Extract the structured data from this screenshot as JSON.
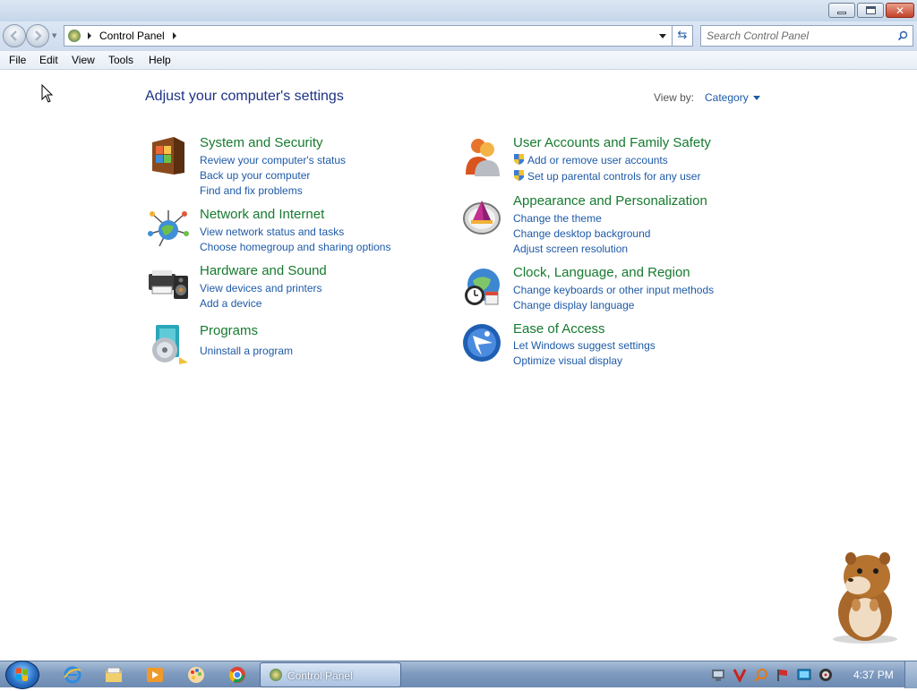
{
  "window": {
    "caption_buttons": {
      "minimize": "minimize",
      "maximize": "maximize",
      "close": "✕"
    }
  },
  "address": {
    "path": "Control Panel",
    "search_placeholder": "Search Control Panel"
  },
  "menu": [
    "File",
    "Edit",
    "View",
    "Tools",
    "Help"
  ],
  "main": {
    "title": "Adjust your computer's settings",
    "view_by_label": "View by:",
    "view_by_value": "Category",
    "categories": [
      {
        "title": "System and Security",
        "icon": "system-security-icon",
        "links": [
          "Review your computer's status",
          "Back up your computer",
          "Find and fix problems"
        ]
      },
      {
        "title": "Network and Internet",
        "icon": "network-internet-icon",
        "links": [
          "View network status and tasks",
          "Choose homegroup and sharing options"
        ]
      },
      {
        "title": "Hardware and Sound",
        "icon": "hardware-sound-icon",
        "links": [
          "View devices and printers",
          "Add a device"
        ]
      },
      {
        "title": "Programs",
        "icon": "programs-icon",
        "links": [
          "Uninstall a program"
        ]
      },
      {
        "title": "User Accounts and Family Safety",
        "icon": "user-accounts-icon",
        "links": [
          "Add or remove user accounts",
          "Set up parental controls for any user"
        ]
      },
      {
        "title": "Appearance and Personalization",
        "icon": "appearance-icon",
        "links": [
          "Change the theme",
          "Change desktop background",
          "Adjust screen resolution"
        ]
      },
      {
        "title": "Clock, Language, and Region",
        "icon": "clock-region-icon",
        "links": [
          "Change keyboards or other input methods",
          "Change display language"
        ]
      },
      {
        "title": "Ease of Access",
        "icon": "ease-of-access-icon",
        "links": [
          "Let Windows suggest settings",
          "Optimize visual display"
        ]
      }
    ]
  },
  "taskbar": {
    "active_task": "Control Panel",
    "clock": "4:37 PM",
    "pinned": [
      "internet-explorer-icon",
      "windows-explorer-icon",
      "media-player-icon",
      "paint-app-icon",
      "chrome-icon"
    ]
  },
  "colors": {
    "title_blue": "#1e3287",
    "category_green": "#167a2f",
    "link_blue": "#1e5aa8"
  }
}
